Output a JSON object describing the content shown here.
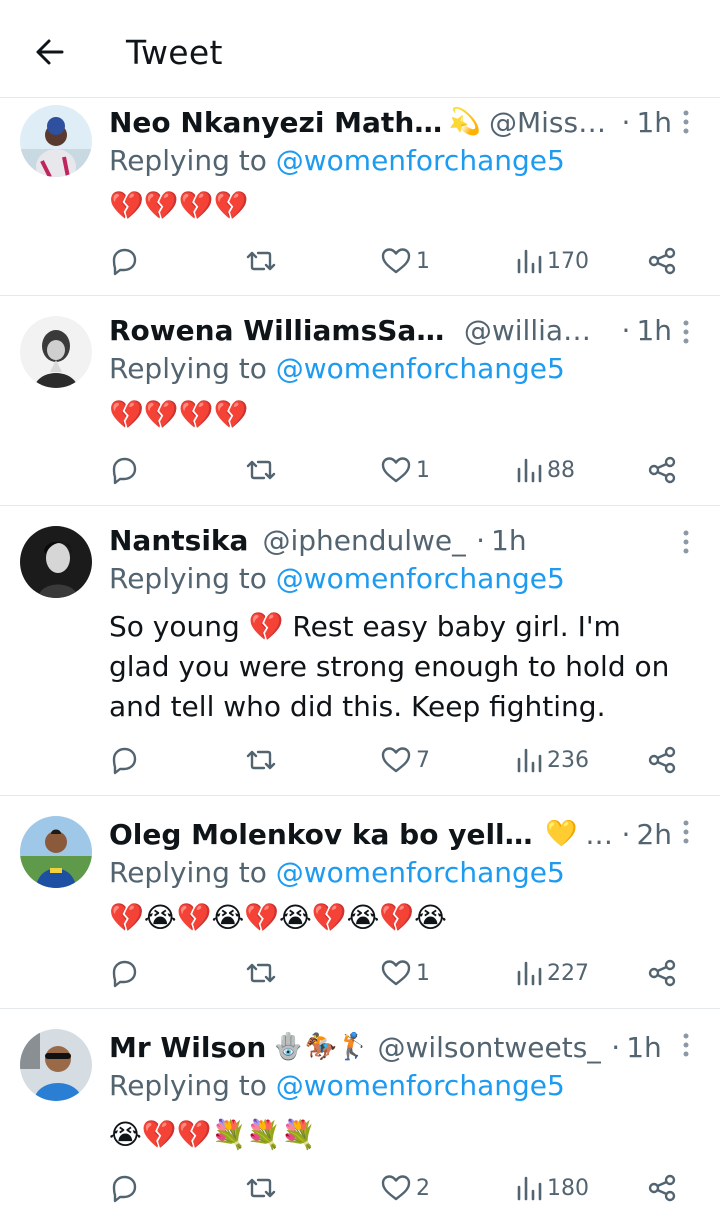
{
  "header": {
    "title": "Tweet"
  },
  "reply_prefix": "Replying to ",
  "tweets": [
    {
      "name": "Neo Nkanyezi Mathala",
      "name_emoji": "💫",
      "handle": "@MissT...",
      "time": "1h",
      "replying_to": "@womenforchange5",
      "text": "💔💔💔💔",
      "likes": "1",
      "views": "170"
    },
    {
      "name": "Rowena WilliamsSauls",
      "name_emoji": "",
      "handle": "@william...",
      "time": "1h",
      "replying_to": "@womenforchange5",
      "text": "💔💔💔💔",
      "likes": "1",
      "views": "88"
    },
    {
      "name": "Nantsika",
      "name_emoji": "",
      "handle": "@iphendulwe_",
      "time": "1h",
      "replying_to": "@womenforchange5",
      "text": "So young 💔 Rest easy baby girl. I'm glad you were strong enough to hold on and tell who did this. Keep fighting.",
      "likes": "7",
      "views": "236"
    },
    {
      "name": "Oleg Molenkov ka bo yellow",
      "name_emoji": "💛",
      "handle": "...",
      "time": "2h",
      "replying_to": "@womenforchange5",
      "text": "💔😭💔😭💔😭💔😭💔😭",
      "likes": "1",
      "views": "227"
    },
    {
      "name": "Mr Wilson",
      "name_emoji": "🪬🏇🏌",
      "handle": "@wilsontweets_",
      "time": "1h",
      "replying_to": "@womenforchange5",
      "text": "😭💔💔💐💐💐",
      "likes": "2",
      "views": "180"
    }
  ],
  "icons": {
    "back": "arrow-left-icon",
    "more": "more-vertical-icon",
    "reply": "reply-icon",
    "retweet": "retweet-icon",
    "like": "heart-icon",
    "views": "views-icon",
    "share": "share-icon"
  },
  "colors": {
    "accent": "#1d9bf0",
    "secondary_text": "#536471",
    "divider": "#e6e9ec"
  }
}
